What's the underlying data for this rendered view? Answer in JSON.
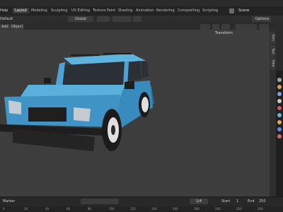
{
  "menu": {
    "label": "Help"
  },
  "tabs": [
    "Layout",
    "Modeling",
    "Sculpting",
    "UV Editing",
    "Texture Paint",
    "Shading",
    "Animation",
    "Rendering",
    "Compositing",
    "Scripting"
  ],
  "scene": {
    "label": "Scene"
  },
  "header": {
    "mode": "Default",
    "transform": "Global",
    "options": "Options"
  },
  "header3": {
    "add": "Add",
    "object": "Object"
  },
  "sidebar": {
    "tabs": [
      "Item",
      "Tool",
      "View"
    ],
    "panel": "Transform"
  },
  "timeline": {
    "marker": "Marker",
    "current_frame": "1/4",
    "start_label": "Start",
    "start_value": "1",
    "end_label": "End",
    "end_value": "250"
  },
  "ruler_ticks": [
    "0",
    "20",
    "40",
    "60",
    "80",
    "100",
    "120",
    "140",
    "160",
    "180",
    "200",
    "220",
    "240"
  ],
  "colors": {
    "car_body": "#4fa3d3",
    "viewport": "#3d3d3d"
  }
}
